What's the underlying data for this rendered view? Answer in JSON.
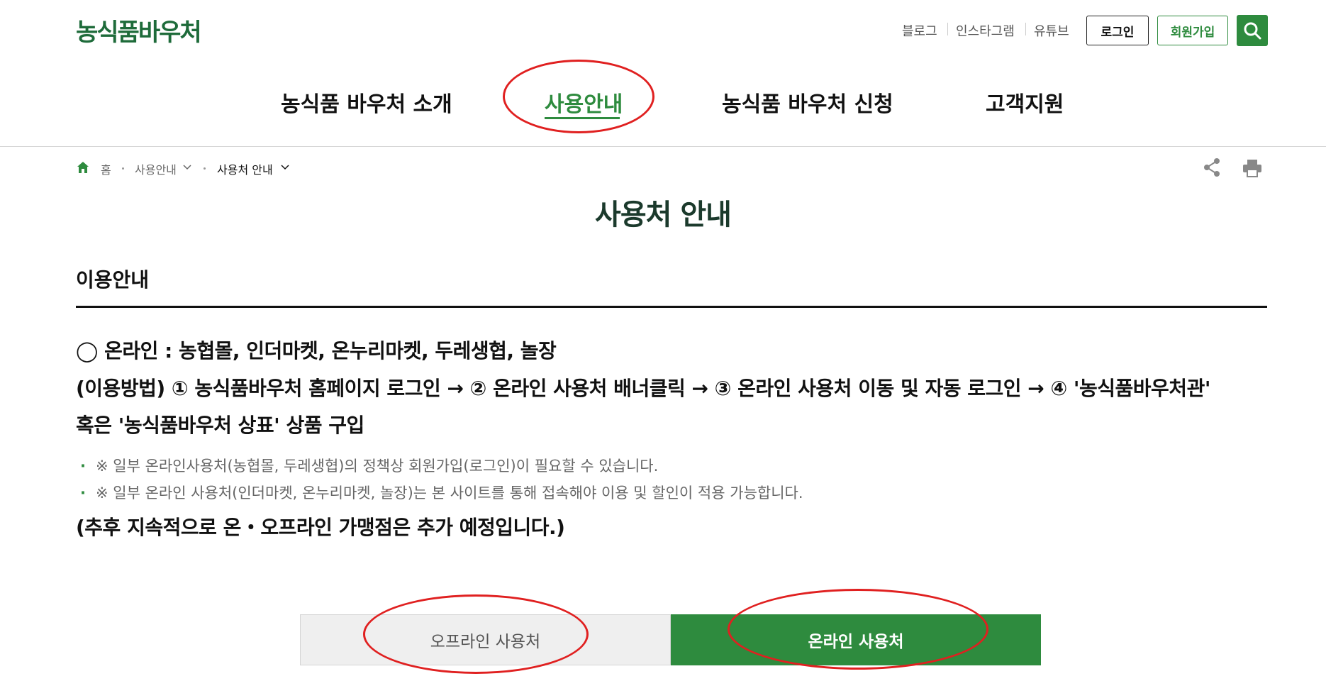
{
  "header": {
    "logo": "농식품바우처",
    "util_links": [
      "블로그",
      "인스타그램",
      "유튜브"
    ],
    "login_label": "로그인",
    "join_label": "회원가입"
  },
  "gnb": [
    "농식품 바우처 소개",
    "사용안내",
    "농식품 바우처 신청",
    "고객지원"
  ],
  "breadcrumb": {
    "home": "홈",
    "level1": "사용안내",
    "level2": "사용처 안내"
  },
  "page_title": "사용처 안내",
  "section_title": "이용안내",
  "content": {
    "line1": "◯ 온라인 : 농협몰, 인더마켓, 온누리마켓, 두레생협, 놀장",
    "line2": "(이용방법) ① 농식품바우처 홈페이지 로그인 → ② 온라인 사용처 배너클릭 → ③ 온라인 사용처 이동 및 자동 로그인 → ④ '농식품바우처관'",
    "line3": "혹은 '농식품바우처 상표' 상품 구입",
    "note1": "※ 일부 온라인사용처(농협몰, 두레생협)의 정책상 회원가입(로그인)이 필요할 수 있습니다.",
    "note2": "※ 일부 온라인 사용처(인더마켓, 온누리마켓, 놀장)는 본 사이트를 통해 접속해야 이용 및 할인이 적용 가능합니다.",
    "line4": "(추후 지속적으로 온・오프라인 가맹점은 추가 예정입니다.)"
  },
  "tabs": {
    "offline": "오프라인 사용처",
    "online": "온라인 사용처"
  },
  "colors": {
    "brand_green": "#2e8b3e",
    "annotation_red": "#e02020"
  }
}
